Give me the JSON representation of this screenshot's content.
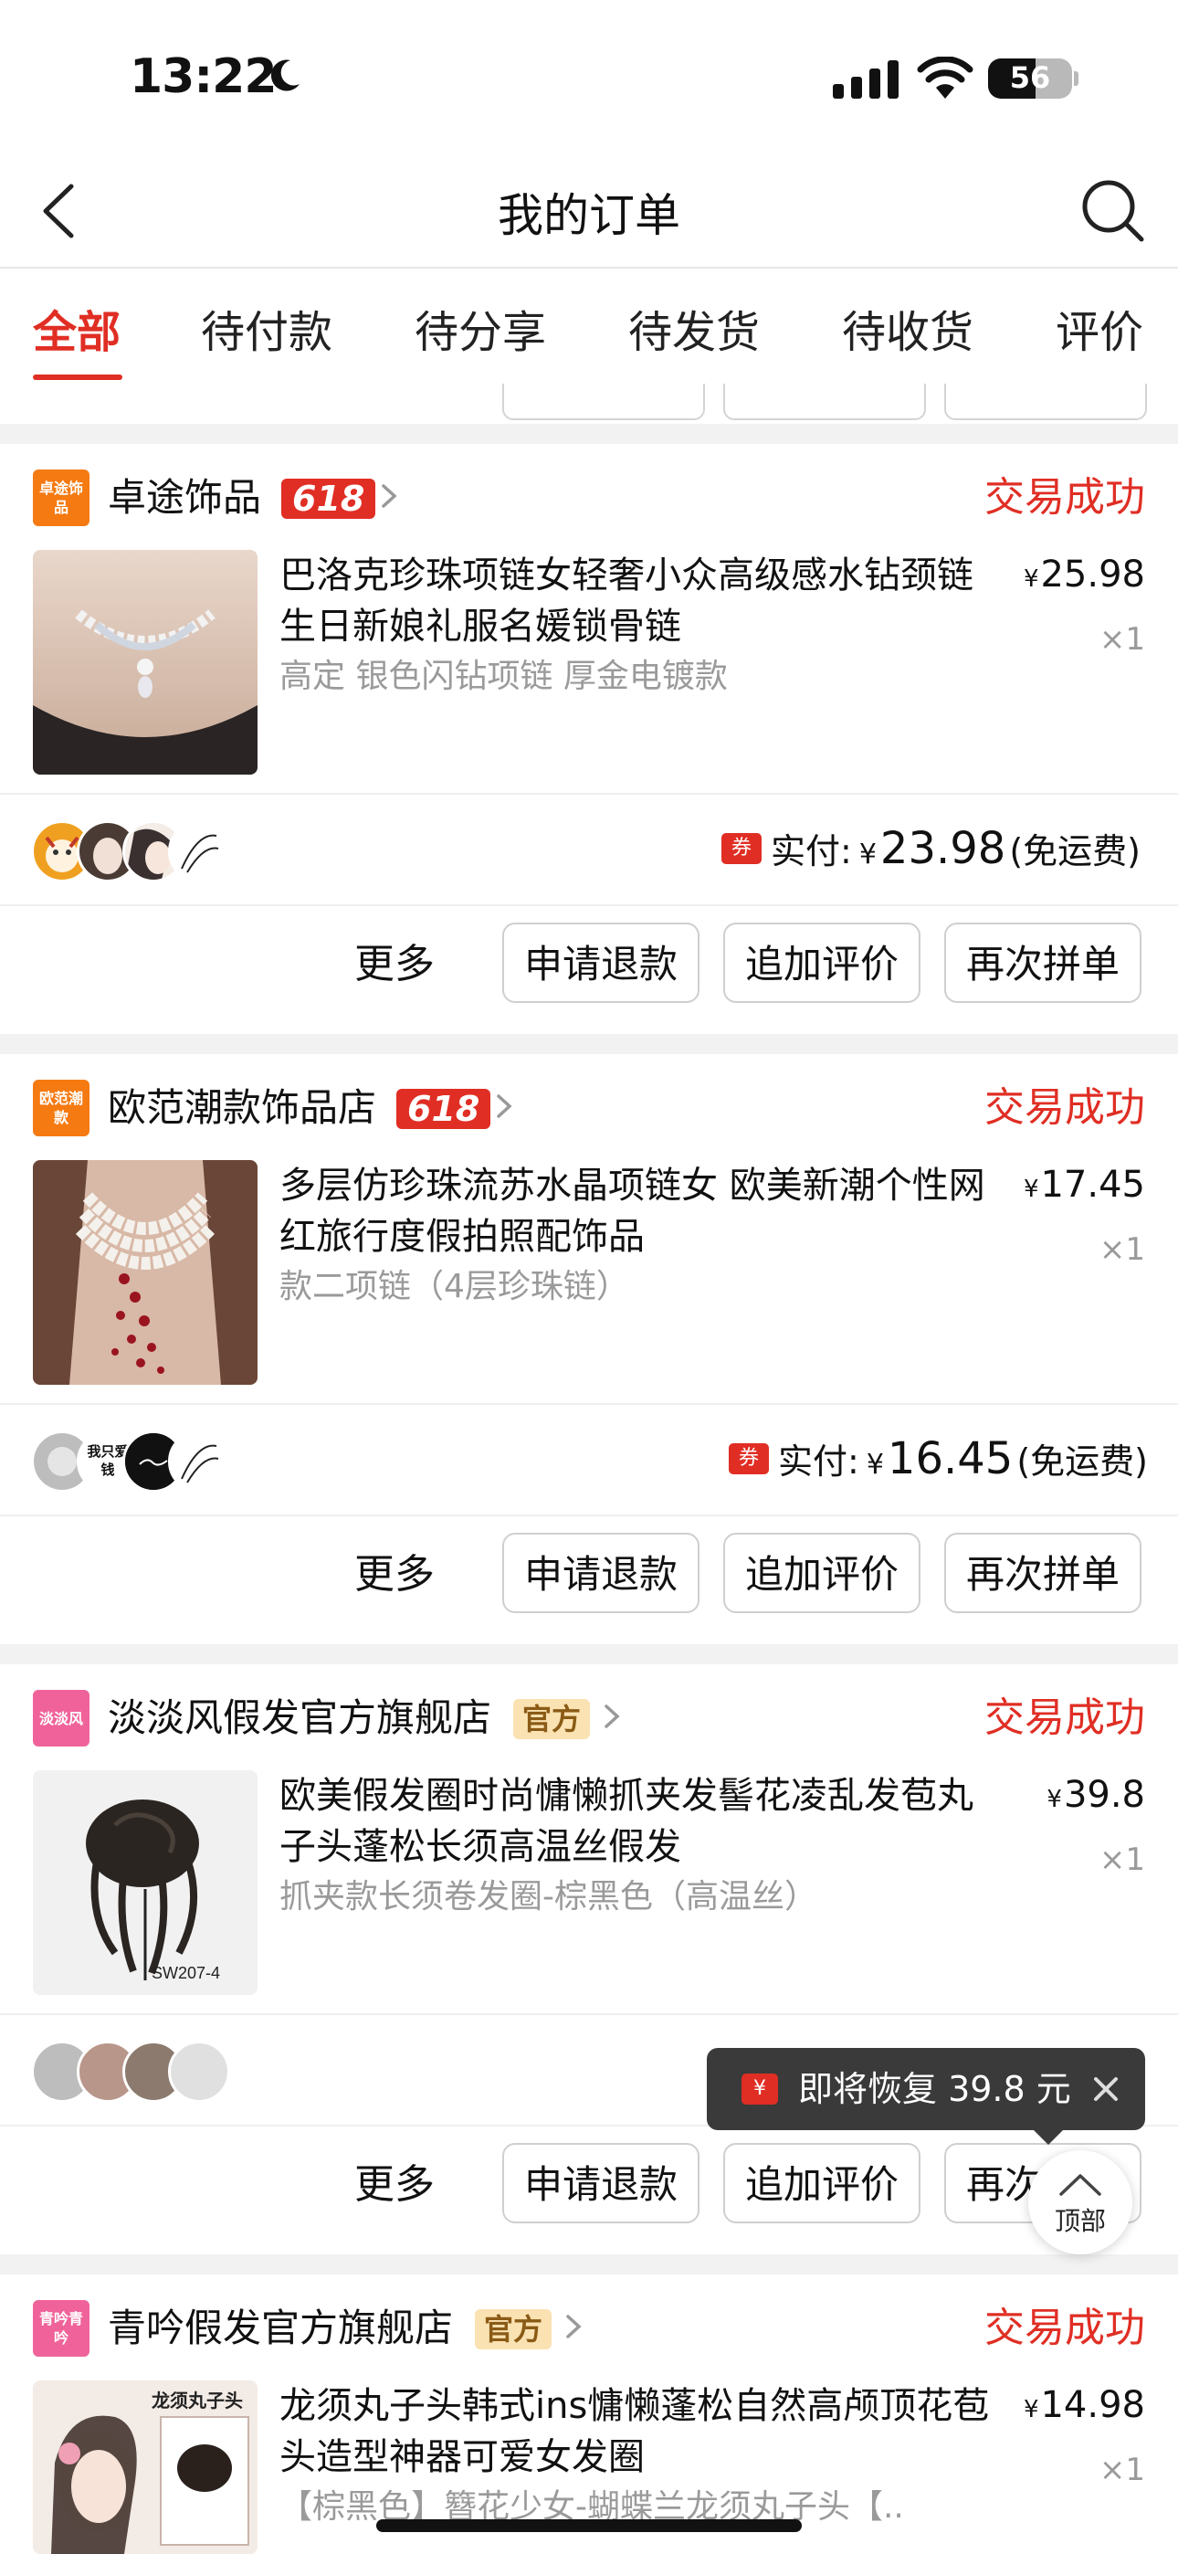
{
  "status_bar": {
    "time": "13:22",
    "battery": "56"
  },
  "nav": {
    "title": "我的订单"
  },
  "tabs": [
    "全部",
    "待付款",
    "待分享",
    "待发货",
    "待收货",
    "评价"
  ],
  "colors": {
    "accent": "#e02e24",
    "official_bg": "#fbe2b2"
  },
  "orders": [
    {
      "shop_logo": "卓途饰品",
      "shop": "卓途饰品",
      "badge": "618",
      "status": "交易成功",
      "title": "巴洛克珍珠项链女轻奢小众高级感水钻颈链生日新娘礼服名媛锁骨链",
      "spec": "高定 银色闪钻项链 厚金电镀款",
      "price": "25.98",
      "qty": "×1",
      "coupon": "券",
      "paid_label": "实付:",
      "yen": "¥",
      "paid": "23.98",
      "shipping": "(免运费)",
      "actions": {
        "more": "更多",
        "refund": "申请退款",
        "review": "追加评价",
        "rebuy": "再次拼单"
      }
    },
    {
      "shop_logo": "欧范潮款",
      "shop": "欧范潮款饰品店",
      "badge": "618",
      "status": "交易成功",
      "title": "多层仿珍珠流苏水晶项链女 欧美新潮个性网红旅行度假拍照配饰品",
      "spec": "款二项链（4层珍珠链）",
      "price": "17.45",
      "qty": "×1",
      "avatar_text": "我只爱钱",
      "coupon": "券",
      "paid_label": "实付:",
      "yen": "¥",
      "paid": "16.45",
      "shipping": "(免运费)",
      "actions": {
        "more": "更多",
        "refund": "申请退款",
        "review": "追加评价",
        "rebuy": "再次拼单"
      }
    },
    {
      "shop_logo": "淡淡风",
      "shop": "淡淡风假发官方旗舰店",
      "badge": "官方",
      "status": "交易成功",
      "title": "欧美假发圈时尚慵懒抓夹发髻花凌乱发苞丸子头蓬松长须高温丝假发",
      "spec": "抓夹款长须卷发圈-棕黑色（高温丝）",
      "price": "39.8",
      "qty": "×1",
      "image_label": "SW207-4",
      "actions": {
        "more": "更多",
        "refund": "申请退款",
        "review": "追加评价",
        "rebuy": "再次拼单"
      }
    },
    {
      "shop_logo": "青吟青吟",
      "shop": "青吟假发官方旗舰店",
      "badge": "官方",
      "status": "交易成功",
      "title": "龙须丸子头韩式ins慵懒蓬松自然高颅顶花苞头造型神器可爱女发圈",
      "spec": "【棕黑色】簪花少女-蝴蝶兰龙须丸子头【..",
      "price": "14.98",
      "qty": "×1",
      "image_label": "龙须丸子头"
    }
  ],
  "toast": {
    "icon": "¥",
    "text": "即将恢复 39.8 元"
  },
  "back_to_top": "顶部"
}
